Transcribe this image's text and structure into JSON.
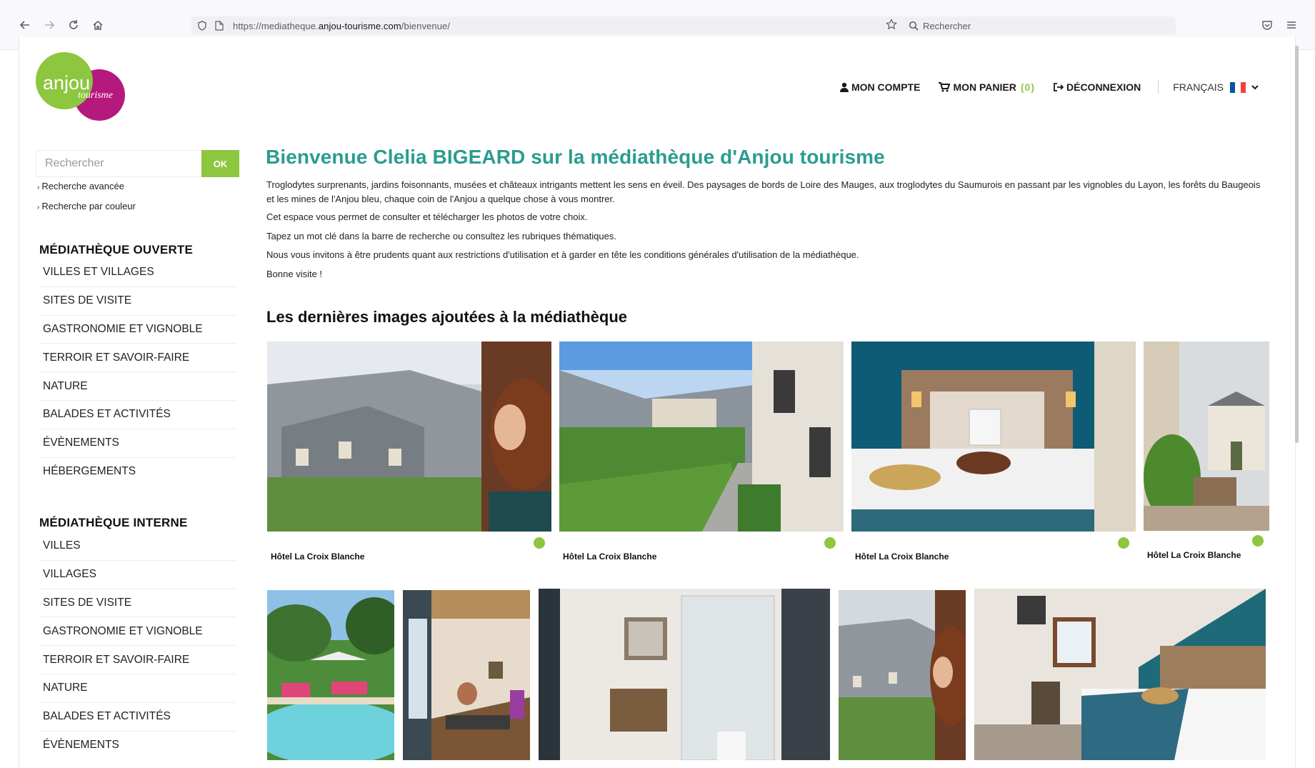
{
  "browser": {
    "url_prefix": "https://mediatheque.",
    "url_domain": "anjou-tourisme.com",
    "url_path": "/bienvenue/",
    "search_placeholder": "Rechercher"
  },
  "logo": {
    "word1": "anjou",
    "word2": "tourisme"
  },
  "header": {
    "account": "MON COMPTE",
    "cart": "MON PANIER",
    "cart_count": "(0)",
    "logout": "DÉCONNEXION",
    "language": "FRANÇAIS"
  },
  "sidebar": {
    "search_placeholder": "Rechercher",
    "search_button": "OK",
    "advanced_search": "Recherche avancée",
    "color_search": "Recherche par couleur",
    "open_title": "MÉDIATHÈQUE OUVERTE",
    "open_items": [
      "VILLES ET VILLAGES",
      "SITES DE VISITE",
      "GASTRONOMIE ET VIGNOBLE",
      "TERROIR ET SAVOIR-FAIRE",
      "NATURE",
      "BALADES ET ACTIVITÉS",
      "ÉVÈNEMENTS",
      "HÉBERGEMENTS"
    ],
    "internal_title": "MÉDIATHÈQUE INTERNE",
    "internal_items": [
      "VILLES",
      "VILLAGES",
      "SITES DE VISITE",
      "GASTRONOMIE ET VIGNOBLE",
      "TERROIR ET SAVOIR-FAIRE",
      "NATURE",
      "BALADES ET ACTIVITÉS",
      "ÉVÈNEMENTS"
    ]
  },
  "main": {
    "title": "Bienvenue Clelia BIGEARD sur la médiathèque d'Anjou tourisme",
    "paragraph1": "Troglodytes surprenants, jardins foisonnants, musées et châteaux intrigants mettent les sens en éveil. Des paysages de bords de Loire des Mauges, aux troglodytes du Saumurois en passant par les vignobles du Layon, les forêts du Baugeois et les mines de l'Anjou bleu, chaque coin de l'Anjou a quelque chose à vous montrer.",
    "paragraph2": "Cet espace vous permet de consulter et télécharger les photos de votre choix.",
    "paragraph3": "Tapez un mot clé dans la barre de recherche ou consultez les rubriques thématiques.",
    "paragraph4": "Nous vous invitons à être prudents quant aux restrictions d'utilisation et à garder en tête les conditions générales d'utilisation de la médiathèque.",
    "paragraph5": "Bonne visite !",
    "latest_title": "Les dernières images ajoutées à la médiathèque",
    "row1_captions": [
      "Hôtel La Croix Blanche",
      "Hôtel La Croix Blanche",
      "Hôtel La Croix Blanche",
      "Hôtel La Croix Blanche"
    ]
  },
  "colors": {
    "accent_green": "#8dc63f",
    "title_teal": "#2a9d8f",
    "logo_magenta": "#b5197e"
  }
}
